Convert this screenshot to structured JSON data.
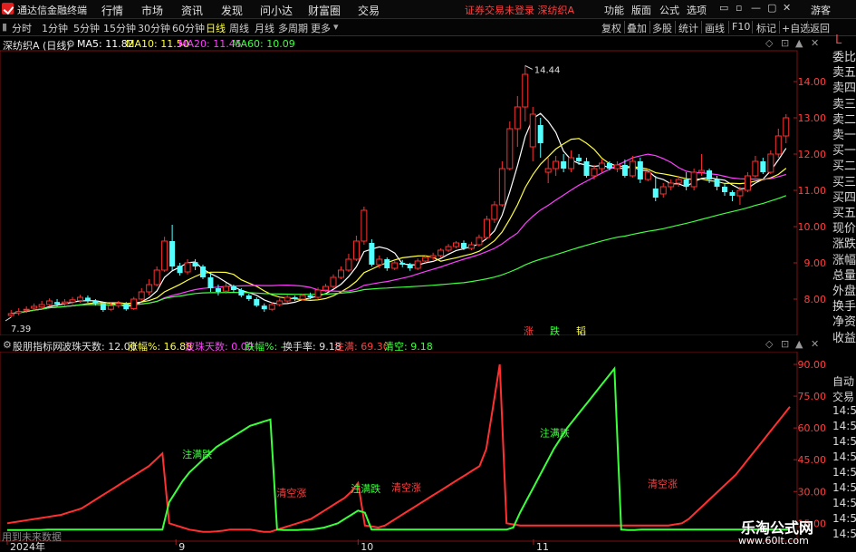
{
  "titlebar": {
    "app_title": "通达信金融终端",
    "menus": [
      "行情",
      "市场",
      "资讯",
      "发现",
      "问小达",
      "财富圈",
      "交易"
    ],
    "notice": "证券交易未登录  深纺织A",
    "right_menus": [
      "功能",
      "版面",
      "公式",
      "选项"
    ],
    "user": "游客",
    "controls": [
      "▭",
      "▫",
      "—",
      "▢",
      "✕"
    ]
  },
  "toolbar": {
    "periods": [
      "分时",
      "1分钟",
      "5分钟",
      "15分钟",
      "30分钟",
      "60分钟",
      "日线",
      "周线",
      "月线",
      "多周期",
      "更多"
    ],
    "active_period": "日线",
    "right_buttons": [
      "复权",
      "叠加",
      "多股",
      "统计",
      "画线",
      "F10",
      "标记",
      "+自选",
      "返回"
    ]
  },
  "chart_header": {
    "stock": "深纺织A (日线)",
    "ma": [
      {
        "label": "MA5: 11.82",
        "color": "#ffffff"
      },
      {
        "label": "MA10: 11.50",
        "color": "#ffff40"
      },
      {
        "label": "MA20: 11.45",
        "color": "#ff40ff"
      },
      {
        "label": "MA60: 10.09",
        "color": "#40ff40"
      }
    ]
  },
  "chart_data": [
    {
      "type": "candlestick",
      "y_ticks": [
        8.0,
        9.0,
        10.0,
        11.0,
        12.0,
        13.0,
        14.0
      ],
      "ylim": [
        7.3,
        14.7
      ],
      "high_label": "14.44",
      "low_label": "7.39",
      "candles": [
        [
          7.55,
          7.6,
          7.5,
          7.7
        ],
        [
          7.62,
          7.66,
          7.55,
          7.75
        ],
        [
          7.7,
          7.72,
          7.62,
          7.8
        ],
        [
          7.75,
          7.8,
          7.68,
          7.88
        ],
        [
          7.78,
          7.85,
          7.72,
          7.95
        ],
        [
          7.85,
          7.95,
          7.8,
          8.02
        ],
        [
          7.92,
          7.86,
          7.8,
          8.0
        ],
        [
          7.88,
          7.92,
          7.82,
          8.0
        ],
        [
          7.92,
          7.98,
          7.86,
          8.06
        ],
        [
          7.96,
          8.05,
          7.9,
          8.12
        ],
        [
          8.04,
          7.96,
          7.9,
          8.1
        ],
        [
          7.96,
          7.88,
          7.82,
          8.0
        ],
        [
          7.88,
          7.7,
          7.65,
          7.92
        ],
        [
          7.72,
          7.82,
          7.68,
          7.9
        ],
        [
          7.82,
          7.88,
          7.76,
          7.95
        ],
        [
          7.88,
          7.72,
          7.68,
          7.92
        ],
        [
          7.74,
          8.0,
          7.7,
          8.06
        ],
        [
          8.0,
          8.2,
          7.96,
          8.3
        ],
        [
          8.2,
          8.4,
          8.1,
          8.55
        ],
        [
          8.4,
          8.8,
          8.35,
          8.9
        ],
        [
          8.8,
          9.6,
          8.75,
          9.72
        ],
        [
          9.6,
          8.9,
          8.8,
          10.05
        ],
        [
          8.92,
          8.72,
          8.65,
          9.0
        ],
        [
          8.75,
          9.0,
          8.68,
          9.1
        ],
        [
          9.02,
          8.9,
          8.8,
          9.1
        ],
        [
          8.9,
          8.6,
          8.55,
          8.95
        ],
        [
          8.6,
          8.3,
          8.2,
          8.7
        ],
        [
          8.3,
          8.2,
          8.1,
          8.4
        ],
        [
          8.22,
          8.35,
          8.15,
          8.45
        ],
        [
          8.35,
          8.25,
          8.18,
          8.4
        ],
        [
          8.25,
          8.1,
          8.05,
          8.3
        ],
        [
          8.1,
          8.0,
          7.95,
          8.15
        ],
        [
          8.0,
          7.82,
          7.78,
          8.05
        ],
        [
          7.82,
          7.72,
          7.65,
          7.88
        ],
        [
          7.72,
          7.85,
          7.68,
          7.92
        ],
        [
          7.85,
          7.95,
          7.8,
          8.02
        ],
        [
          7.95,
          8.05,
          7.9,
          8.12
        ],
        [
          8.05,
          8.0,
          7.95,
          8.1
        ],
        [
          8.0,
          8.1,
          7.96,
          8.15
        ],
        [
          8.1,
          8.05,
          8.0,
          8.18
        ],
        [
          8.05,
          8.25,
          8.0,
          8.32
        ],
        [
          8.25,
          8.35,
          8.2,
          8.42
        ],
        [
          8.35,
          8.6,
          8.3,
          8.68
        ],
        [
          8.6,
          8.8,
          8.55,
          8.9
        ],
        [
          8.8,
          9.1,
          8.75,
          9.25
        ],
        [
          9.1,
          9.6,
          9.05,
          9.75
        ],
        [
          9.6,
          10.45,
          9.5,
          10.55
        ],
        [
          9.55,
          8.95,
          8.9,
          9.65
        ],
        [
          8.95,
          9.1,
          8.85,
          9.2
        ],
        [
          9.1,
          8.85,
          8.78,
          9.15
        ],
        [
          8.85,
          9.0,
          8.8,
          9.05
        ],
        [
          9.0,
          8.95,
          8.88,
          9.08
        ],
        [
          8.95,
          8.85,
          8.78,
          9.0
        ],
        [
          8.85,
          9.05,
          8.8,
          9.12
        ],
        [
          9.05,
          9.15,
          9.0,
          9.2
        ],
        [
          9.15,
          9.2,
          9.08,
          9.28
        ],
        [
          9.2,
          9.35,
          9.15,
          9.4
        ],
        [
          9.35,
          9.45,
          9.3,
          9.52
        ],
        [
          9.45,
          9.55,
          9.4,
          9.6
        ],
        [
          9.55,
          9.4,
          9.35,
          9.62
        ],
        [
          9.4,
          9.5,
          9.35,
          9.58
        ],
        [
          9.5,
          9.7,
          9.45,
          9.78
        ],
        [
          9.7,
          10.2,
          9.65,
          10.3
        ],
        [
          10.2,
          10.6,
          10.1,
          10.7
        ],
        [
          10.6,
          11.6,
          10.55,
          11.8
        ],
        [
          11.6,
          12.7,
          11.55,
          12.9
        ],
        [
          12.7,
          13.3,
          12.2,
          13.6
        ],
        [
          13.3,
          14.2,
          12.9,
          14.44
        ],
        [
          12.2,
          13.1,
          11.8,
          13.3
        ],
        [
          12.8,
          12.3,
          11.9,
          13.0
        ],
        [
          11.5,
          11.6,
          11.2,
          11.9
        ],
        [
          11.6,
          11.8,
          11.4,
          11.95
        ],
        [
          11.8,
          11.6,
          11.5,
          12.0
        ],
        [
          11.6,
          11.9,
          11.5,
          12.1
        ],
        [
          11.9,
          11.8,
          11.7,
          12.0
        ],
        [
          11.8,
          11.4,
          11.35,
          11.9
        ],
        [
          11.4,
          11.6,
          11.3,
          11.7
        ],
        [
          11.6,
          11.75,
          11.5,
          11.85
        ],
        [
          11.75,
          11.6,
          11.55,
          11.8
        ],
        [
          11.6,
          11.7,
          11.5,
          11.8
        ],
        [
          11.7,
          11.4,
          11.35,
          11.85
        ],
        [
          11.4,
          11.8,
          11.35,
          11.95
        ],
        [
          11.8,
          11.3,
          11.2,
          11.9
        ],
        [
          11.3,
          11.5,
          11.25,
          11.6
        ],
        [
          11.05,
          10.8,
          10.7,
          11.4
        ],
        [
          10.9,
          11.1,
          10.8,
          11.2
        ],
        [
          11.1,
          11.2,
          11.0,
          11.3
        ],
        [
          11.2,
          11.3,
          11.1,
          11.4
        ],
        [
          11.3,
          11.1,
          11.0,
          11.5
        ],
        [
          11.1,
          11.5,
          11.0,
          11.6
        ],
        [
          11.5,
          11.55,
          11.4,
          12.0
        ],
        [
          11.55,
          11.3,
          11.2,
          11.6
        ],
        [
          11.3,
          11.1,
          11.0,
          11.4
        ],
        [
          11.1,
          10.95,
          10.85,
          11.2
        ],
        [
          10.95,
          10.85,
          10.7,
          11.0
        ],
        [
          10.85,
          11.0,
          10.6,
          11.1
        ],
        [
          11.0,
          11.4,
          10.95,
          11.5
        ],
        [
          11.4,
          11.8,
          11.35,
          11.95
        ],
        [
          11.8,
          11.5,
          11.45,
          11.9
        ],
        [
          11.5,
          12.0,
          11.45,
          12.1
        ],
        [
          12.0,
          12.5,
          11.9,
          12.7
        ],
        [
          12.5,
          13.0,
          12.3,
          13.1
        ]
      ],
      "signals": [
        {
          "label": "涨",
          "color": "#ff4040"
        },
        {
          "label": "跌",
          "color": "#40ff40"
        },
        {
          "label": "韬",
          "color": "#ffff40"
        }
      ]
    },
    {
      "type": "line",
      "title": "股朋指标网",
      "y_ticks": [
        15.0,
        30.0,
        45.0,
        60.0,
        75.0,
        90.0
      ],
      "ylim": [
        10,
        96
      ],
      "series_red": [
        15,
        15.5,
        16,
        16.5,
        17,
        17.5,
        18,
        18.5,
        19,
        20,
        21,
        22,
        24,
        26,
        28,
        30,
        32,
        34,
        36,
        38,
        40,
        42,
        45,
        48,
        15,
        14,
        13,
        12,
        11.5,
        11,
        11,
        11.2,
        11.5,
        12,
        12,
        12,
        12,
        11.5,
        11,
        11,
        12,
        13,
        14,
        15,
        16,
        17,
        19,
        21,
        23,
        25,
        27,
        30,
        34,
        14,
        13.5,
        13,
        14,
        16,
        18,
        20,
        22,
        24,
        26,
        28,
        30,
        32,
        34,
        36,
        38,
        40,
        42,
        50,
        70,
        90,
        15,
        14.5,
        14,
        14,
        14,
        14,
        14,
        14,
        14,
        14,
        14,
        14,
        14,
        14,
        14,
        14,
        14,
        14,
        14,
        14,
        14,
        14,
        14,
        14,
        14,
        14.5,
        15,
        17,
        20,
        23,
        26,
        29,
        32,
        35,
        38,
        42,
        46,
        50,
        54,
        58,
        62,
        66,
        70
      ],
      "series_green": [
        11.8,
        11.8,
        11.8,
        11.9,
        11.9,
        11.9,
        12,
        12,
        12,
        12,
        12,
        12,
        12,
        12,
        12,
        12,
        12,
        12,
        12,
        12,
        12,
        12,
        12,
        12,
        25,
        30,
        35,
        39,
        42,
        45,
        48,
        51,
        53,
        55,
        57,
        59,
        61,
        62,
        63,
        64,
        12,
        11.8,
        11.8,
        11.8,
        12,
        12,
        12.5,
        13,
        14,
        15,
        17,
        19,
        21,
        20,
        12,
        12,
        12,
        12,
        12,
        12,
        12,
        12,
        12,
        12,
        12,
        12,
        12,
        12,
        12,
        12,
        12,
        12,
        12,
        12,
        12,
        13,
        20,
        26,
        32,
        38,
        44,
        50,
        55,
        60,
        64,
        68,
        72,
        76,
        80,
        84,
        88,
        12,
        11.8,
        11.8,
        12,
        12,
        12,
        12,
        12,
        12,
        12,
        12,
        12,
        12,
        12,
        12,
        12,
        12,
        12,
        12,
        12,
        12,
        12,
        12,
        12,
        12,
        12
      ],
      "annotations": [
        {
          "label": "注满跌",
          "color": "#40ff40"
        },
        {
          "label": "清空涨",
          "color": "#ff4040"
        },
        {
          "label": "注满跌",
          "color": "#40ff40"
        },
        {
          "label": "清空涨",
          "color": "#ff4040"
        },
        {
          "label": "注满跌",
          "color": "#40ff40"
        },
        {
          "label": "清空涨",
          "color": "#ff4040"
        }
      ],
      "x_ticks": [
        "2024年",
        "9",
        "10",
        "11"
      ]
    }
  ],
  "indicator_header": [
    {
      "label": "股朋指标网",
      "color": "#e0e0e0"
    },
    {
      "label": "波珠天数: 12.00",
      "color": "#e0e0e0"
    },
    {
      "label": "涨幅%: 16.88",
      "color": "#ffff40"
    },
    {
      "label": "波珠天数: 0.00",
      "color": "#ff40ff"
    },
    {
      "label": "跌幅%: -",
      "color": "#40ff40"
    },
    {
      "label": "换手率: 9.18",
      "color": "#e0e0e0"
    },
    {
      "label": "注满: 69.30",
      "color": "#ff4040"
    },
    {
      "label": "清空: 9.18",
      "color": "#40ff40"
    }
  ],
  "sidebar": {
    "items": [
      {
        "label": "委比",
        "color": "#d8d8d8"
      },
      {
        "label": "卖五",
        "color": "#d8d8d8"
      },
      {
        "label": "卖四",
        "color": "#d8d8d8"
      },
      {
        "label": "卖三",
        "color": "#d8d8d8"
      },
      {
        "label": "卖二",
        "color": "#d8d8d8"
      },
      {
        "label": "卖一",
        "color": "#d8d8d8"
      },
      {
        "label": "买一",
        "color": "#d8d8d8"
      },
      {
        "label": "买二",
        "color": "#d8d8d8"
      },
      {
        "label": "买三",
        "color": "#d8d8d8"
      },
      {
        "label": "买四",
        "color": "#d8d8d8"
      },
      {
        "label": "买五",
        "color": "#d8d8d8"
      },
      {
        "label": "现价",
        "color": "#d8d8d8"
      },
      {
        "label": "涨跌",
        "color": "#d8d8d8"
      },
      {
        "label": "涨幅",
        "color": "#d8d8d8"
      },
      {
        "label": "总量",
        "color": "#d8d8d8"
      },
      {
        "label": "外盘",
        "color": "#d8d8d8"
      },
      {
        "label": "换手",
        "color": "#d8d8d8"
      },
      {
        "label": "净资",
        "color": "#d8d8d8"
      },
      {
        "label": "收益",
        "color": "#d8d8d8"
      }
    ],
    "lower": [
      "自动",
      "交易",
      "14:5",
      "14:5",
      "14:5",
      "14:5",
      "14:5",
      "14:5",
      "14:5",
      "14:5",
      "14:5"
    ],
    "top_mark": "L"
  },
  "footer": {
    "bottom_left": "用到未来数据",
    "watermark_title": "乐淘公式网",
    "watermark_url": "www.60lt.com"
  }
}
